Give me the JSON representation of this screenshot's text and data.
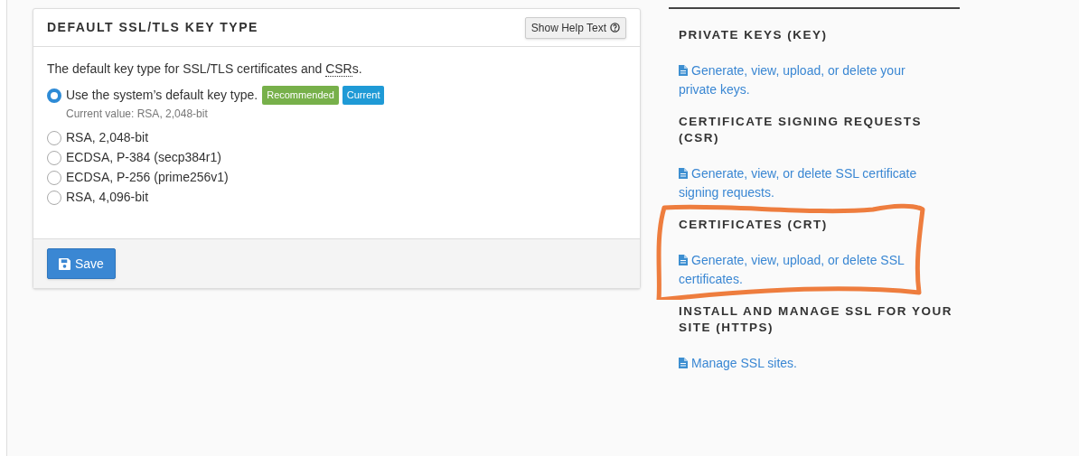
{
  "card": {
    "title": "DEFAULT SSL/TLS KEY TYPE",
    "help_button": "Show Help Text",
    "description": [
      {
        "kind": "text",
        "text": "The default key type for SSL/TLS certificates and "
      },
      {
        "kind": "abbr",
        "text": "CSR"
      },
      {
        "kind": "text",
        "text": "s."
      }
    ],
    "options": [
      {
        "label": "Use the system’s default key type.",
        "selected": true,
        "badges": [
          {
            "text": "Recommended",
            "color": "#77b04a"
          },
          {
            "text": "Current",
            "color": "#1f9ad6"
          }
        ],
        "note": "Current value: RSA, 2,048-bit"
      },
      {
        "label": "RSA, 2,048-bit",
        "selected": false
      },
      {
        "label": "ECDSA, P-384 (secp384r1)",
        "selected": false
      },
      {
        "label": "ECDSA, P-256 (prime256v1)",
        "selected": false
      },
      {
        "label": "RSA, 4,096-bit",
        "selected": false
      }
    ],
    "save_button": "Save"
  },
  "sidebar": {
    "sections": [
      {
        "heading": "PRIVATE KEYS (KEY)",
        "link": "Generate, view, upload, or delete your private keys.",
        "highlighted": false
      },
      {
        "heading": "CERTIFICATE SIGNING REQUESTS (CSR)",
        "link": "Generate, view, or delete SSL certificate signing requests.",
        "highlighted": false
      },
      {
        "heading": "CERTIFICATES (CRT)",
        "link": "Generate, view, upload, or delete SSL certificates.",
        "highlighted": true
      },
      {
        "heading": "INSTALL AND MANAGE SSL FOR YOUR SITE (HTTPS)",
        "link": "Manage SSL sites.",
        "highlighted": false
      }
    ]
  }
}
